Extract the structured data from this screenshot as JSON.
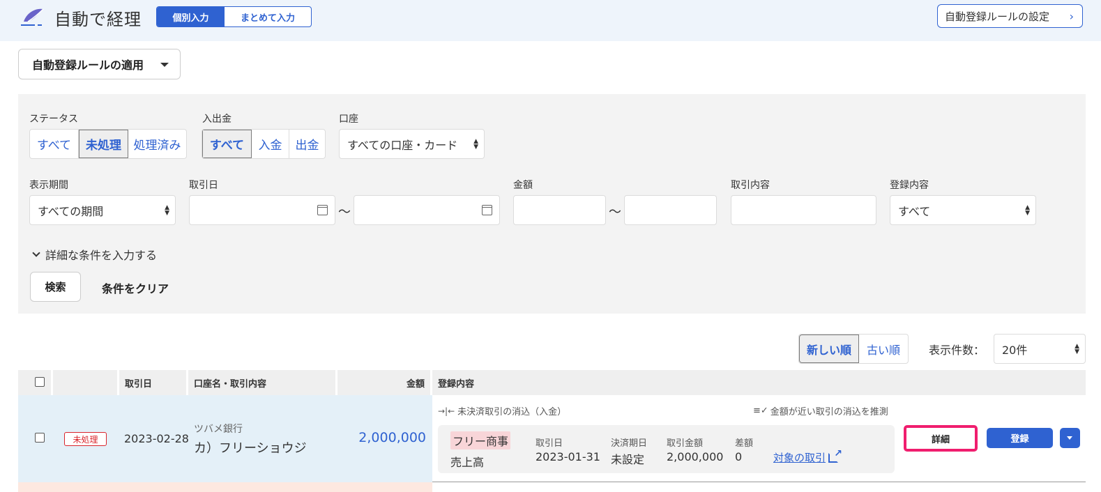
{
  "header": {
    "app_title": "自動で経理",
    "mode_tabs": [
      "個別入力",
      "まとめて入力"
    ],
    "rule_settings_label": "自動登録ルールの設定"
  },
  "apply_rule": {
    "label": "自動登録ルールの適用"
  },
  "filters": {
    "status": {
      "label": "ステータス",
      "options": [
        "すべて",
        "未処理",
        "処理済み"
      ],
      "selected": "未処理"
    },
    "direction": {
      "label": "入出金",
      "options": [
        "すべて",
        "入金",
        "出金"
      ],
      "selected": "すべて"
    },
    "account": {
      "label": "口座",
      "value": "すべての口座・カード"
    },
    "period": {
      "label": "表示期間",
      "value": "すべての期間"
    },
    "trade_date": {
      "label": "取引日",
      "separator": "〜"
    },
    "amount": {
      "label": "金額",
      "separator": "〜"
    },
    "trade_content": {
      "label": "取引内容"
    },
    "registration": {
      "label": "登録内容",
      "value": "すべて"
    },
    "detail_toggle": "詳細な条件を入力する",
    "search_label": "検索",
    "clear_label": "条件をクリア"
  },
  "sort": {
    "options": [
      "新しい順",
      "古い順"
    ],
    "selected": "新しい順"
  },
  "page_size": {
    "label": "表示件数：",
    "value": "20件"
  },
  "table": {
    "headers": {
      "date": "取引日",
      "account": "口座名・取引内容",
      "amount": "金額",
      "registration": "登録内容"
    },
    "rows": [
      {
        "status": "未処理",
        "date": "2023-02-28",
        "bank": "ツバメ銀行",
        "description": "カ）フリーショウジ",
        "amount": "2,000,000",
        "hint_left": "未決済取引の消込（入金）",
        "hint_right": "金額が近い取引の消込を推測",
        "partner": "フリー商事",
        "account_item": "売上高",
        "card": {
          "labels": [
            "取引日",
            "決済期日",
            "取引金額",
            "差額"
          ],
          "values": [
            "2023-01-31",
            "未設定",
            "2,000,000",
            "0"
          ],
          "link": "対象の取引"
        },
        "detail_label": "詳細",
        "register_label": "登録"
      }
    ]
  },
  "colors": {
    "accent": "#2f62d1",
    "status_red": "#d9242b",
    "highlight": "#f01e6e"
  }
}
